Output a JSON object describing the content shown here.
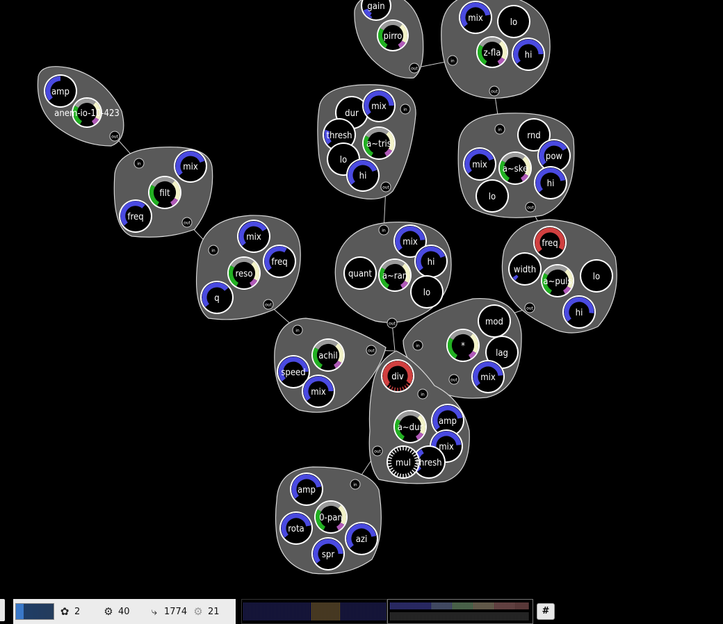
{
  "modules": [
    {
      "id": "m_anem",
      "label": "anem-io-10-423",
      "ports": [
        "amp"
      ],
      "ins": [],
      "outs": [
        "out"
      ],
      "arcs": {
        "amp": "blue"
      }
    },
    {
      "id": "m_gain",
      "label": "pirro",
      "ports": [
        "gain"
      ],
      "outs": [
        "out"
      ]
    },
    {
      "id": "m_zfla",
      "label": "z-fla",
      "ports": [
        "mix",
        "lo",
        "hi"
      ],
      "ins": [
        "in"
      ],
      "outs": [
        "out"
      ]
    },
    {
      "id": "m_filt",
      "label": "filt",
      "ports": [
        "mix",
        "freq"
      ],
      "ins": [
        "in"
      ],
      "outs": [
        "out"
      ]
    },
    {
      "id": "m_tris",
      "label": "a~tris",
      "ports": [
        "dur",
        "mix",
        "thresh",
        "lo",
        "hi"
      ],
      "ins": [
        "in"
      ],
      "outs": [
        "out"
      ]
    },
    {
      "id": "m_ske",
      "label": "a~ske",
      "ports": [
        "rnd",
        "pow",
        "mix",
        "hi",
        "lo"
      ],
      "ins": [
        "in"
      ],
      "outs": [
        "out"
      ]
    },
    {
      "id": "m_reso",
      "label": "reso",
      "ports": [
        "mix",
        "freq",
        "q"
      ],
      "ins": [
        "in"
      ],
      "outs": [
        "out"
      ]
    },
    {
      "id": "m_ran",
      "label": "a~ran",
      "ports": [
        "quant",
        "mix",
        "hi",
        "lo"
      ],
      "ins": [
        "in"
      ],
      "outs": [
        "out"
      ]
    },
    {
      "id": "m_puls",
      "label": "a~puls",
      "ports": [
        "freq",
        "width",
        "lo",
        "hi"
      ],
      "ins": [],
      "outs": [
        "out"
      ]
    },
    {
      "id": "m_achi",
      "label": "achil",
      "ports": [
        "speed",
        "mix"
      ],
      "ins": [
        "in"
      ],
      "outs": [
        "out"
      ]
    },
    {
      "id": "m_mult",
      "label": "*",
      "ports": [
        "mod",
        "lag",
        "mix"
      ],
      "ins": [
        "in"
      ],
      "outs": [
        "out"
      ]
    },
    {
      "id": "m_dur",
      "label": "a~dur",
      "ports": [
        "div",
        "amp",
        "mix",
        "thresh",
        "mul"
      ],
      "ins": [
        "in"
      ],
      "outs": [
        "out"
      ]
    },
    {
      "id": "m_pan",
      "label": "0-pan",
      "ports": [
        "amp",
        "rota",
        "spr",
        "azi"
      ],
      "ins": [
        "in"
      ],
      "outs": []
    }
  ],
  "status": {
    "patches": "2",
    "modules": "40",
    "connections": "1774",
    "load": "21",
    "hash_button": "#"
  },
  "colors": {
    "background": "#000000",
    "module_fill": "#595959",
    "module_stroke": "#d8d8d8",
    "knob_blue": "#4a4ae0",
    "knob_green": "#22b022",
    "knob_purple": "#b05ab8",
    "knob_red": "#d04040",
    "knob_cream": "#f2f2c8",
    "knob_lime": "#b8e890"
  }
}
